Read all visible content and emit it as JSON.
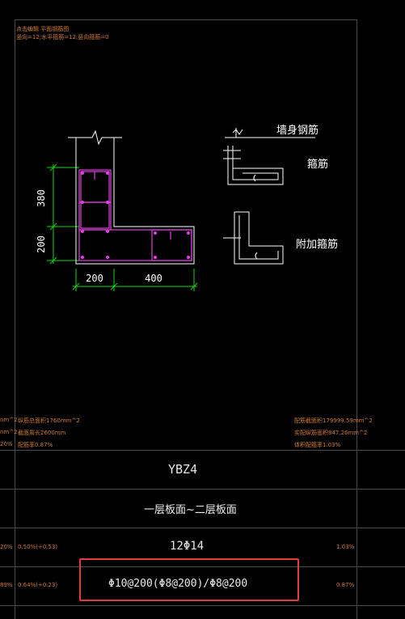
{
  "header_note": {
    "line1": "点击编辑 平面钢筋图",
    "line2": "竖向=12;水平箍筋=12;竖向箍筋=0"
  },
  "drawing": {
    "dims": {
      "v_top": "380",
      "v_bottom": "200",
      "h_left": "200",
      "h_right": "400"
    },
    "labels": {
      "wall_rebar": "墙身钢筋",
      "stirrup": "箍筋",
      "extra_tie": "附加箍筋"
    }
  },
  "stats": {
    "left": [
      "纵筋总面积1760mm^2",
      "截面周长2600mm",
      "配筋率0.87%"
    ],
    "right": [
      "配筋截面积179999.59mm^2",
      "实配纵筋面积847.26mm^2",
      "体积配箍率1.03%"
    ]
  },
  "left_edge": {
    "top": [
      "nm^2",
      "nm^2",
      "20%"
    ],
    "row_rebar": "20%",
    "row_stirrup": "89%"
  },
  "table": {
    "name": "YBZ4",
    "floor_range": "一层板面~二层板面",
    "longitudinal": "12Φ14",
    "long_ratio": "0.50%(+0.53)",
    "long_ratio_right": "1.03%",
    "stirrup": "Φ10@200(Φ8@200)/Φ8@200",
    "stirrup_ratio": "0.64%(+0.23)",
    "stirrup_ratio_right": "0.87%"
  },
  "colors": {
    "background": "#000000",
    "grid": "#4a4a4a",
    "outline": "#ffffff",
    "rebar": "#e040e0",
    "dimension": "#19d219",
    "note": "#d27a2c",
    "highlight": "#e23b3b"
  }
}
